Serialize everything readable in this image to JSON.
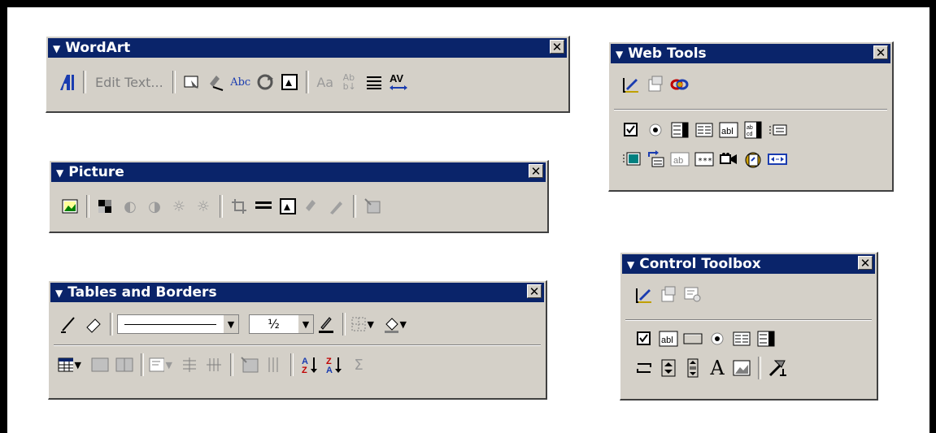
{
  "wordart": {
    "title": "WordArt",
    "edit_text": "Edit Text...",
    "buttons_a": [
      "wordart-icon"
    ],
    "buttons_b": [
      "gallery-icon",
      "format-icon",
      "shape-icon",
      "rotate-icon",
      "wrap-icon"
    ],
    "buttons_c": [
      "same-height-icon",
      "vertical-text-icon",
      "alignment-icon",
      "spacing-icon"
    ]
  },
  "picture": {
    "title": "Picture"
  },
  "tables": {
    "title": "Tables and Borders",
    "line_weight": "½"
  },
  "webtools": {
    "title": "Web Tools"
  },
  "control": {
    "title": "Control Toolbox"
  },
  "glyphs": {
    "close": "✕",
    "triangle": "▼",
    "dropdown": "▼",
    "sigma": "Σ",
    "big_a": "A"
  }
}
